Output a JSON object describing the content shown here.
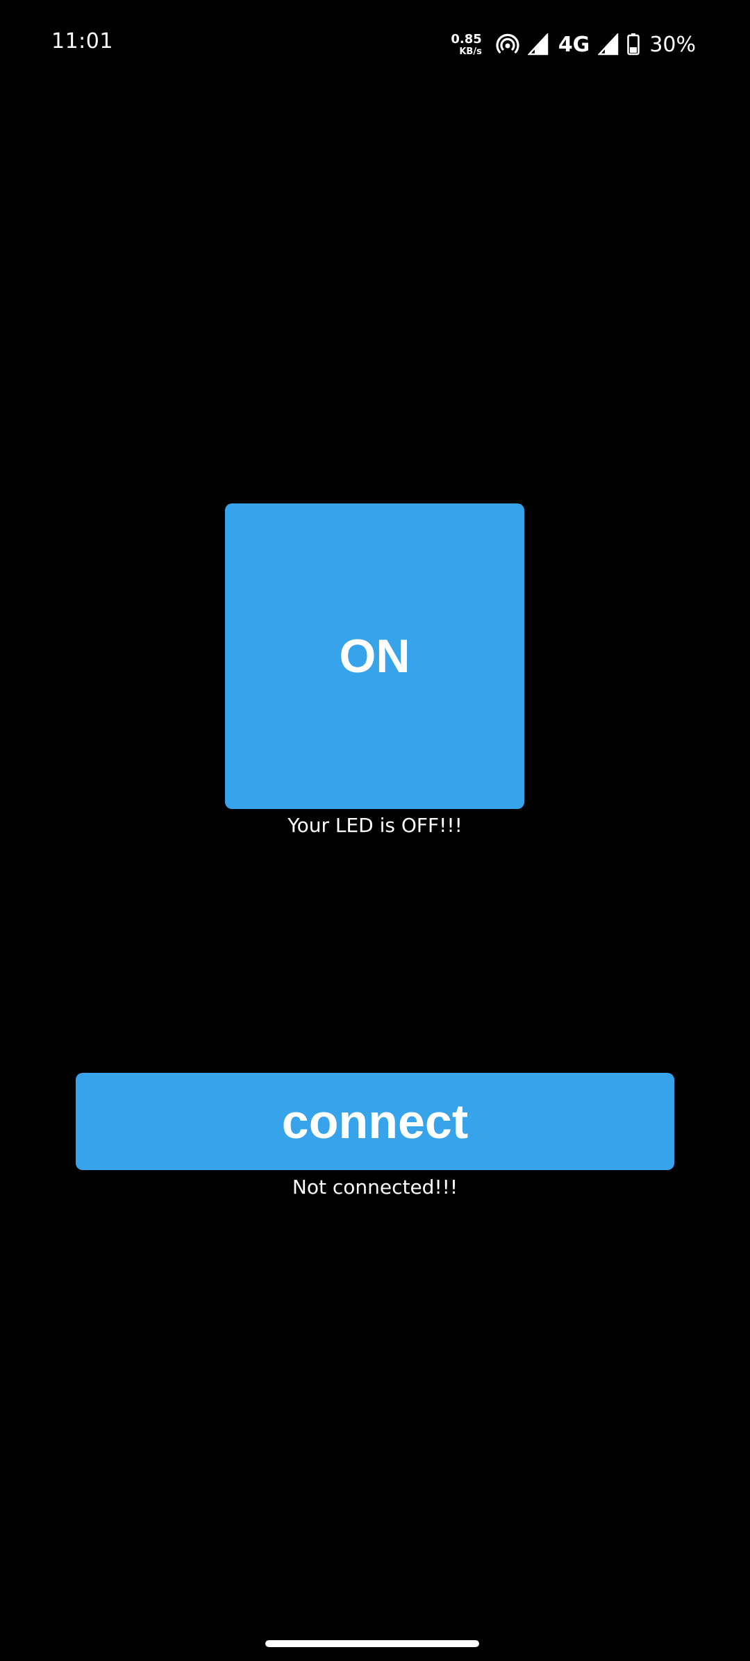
{
  "status_bar": {
    "time": "11:01",
    "net_speed_value": "0.85",
    "net_speed_unit": "KB/s",
    "network_type": "4G",
    "battery_percent": "30%",
    "icons": [
      "hotspot-icon",
      "signal-icon",
      "signal-icon",
      "battery-icon"
    ]
  },
  "led_control": {
    "button_label": "ON",
    "status_text": "Your LED is OFF!!!"
  },
  "connection": {
    "button_label": "connect",
    "status_text": "Not connected!!!"
  },
  "colors": {
    "background": "#000000",
    "accent": "#37a3eb",
    "text": "#ffffff"
  }
}
